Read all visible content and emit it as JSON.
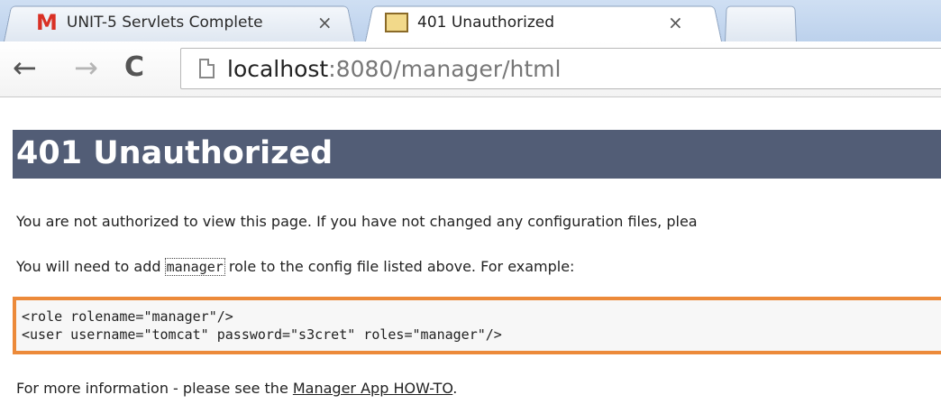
{
  "tabs": [
    {
      "icon": "gmail-icon",
      "title": "UNIT-5 Servlets Complete",
      "close": "×"
    },
    {
      "icon": "tomcat-icon",
      "title": "401 Unauthorized",
      "close": "×"
    }
  ],
  "toolbar": {
    "back": "←",
    "forward": "→",
    "reload": "C",
    "url_host": "localhost",
    "url_rest": ":8080/manager/html"
  },
  "page": {
    "heading": "401 Unauthorized",
    "para1": "You are not authorized to view this page. If you have not changed any configuration files, plea",
    "para2_before": "You will need to add ",
    "para2_code": "manager",
    "para2_after": " role to the config file listed above. For example:",
    "code_lines": [
      "<role rolename=\"manager\"/>",
      "<user username=\"tomcat\" password=\"s3cret\" roles=\"manager\"/>"
    ],
    "para3_before": "For more information - please see the ",
    "para3_link": "Manager App HOW-TO",
    "para3_after": ".",
    "colors": {
      "heading_bg": "#525d76",
      "code_border": "#ec8a3a"
    }
  }
}
